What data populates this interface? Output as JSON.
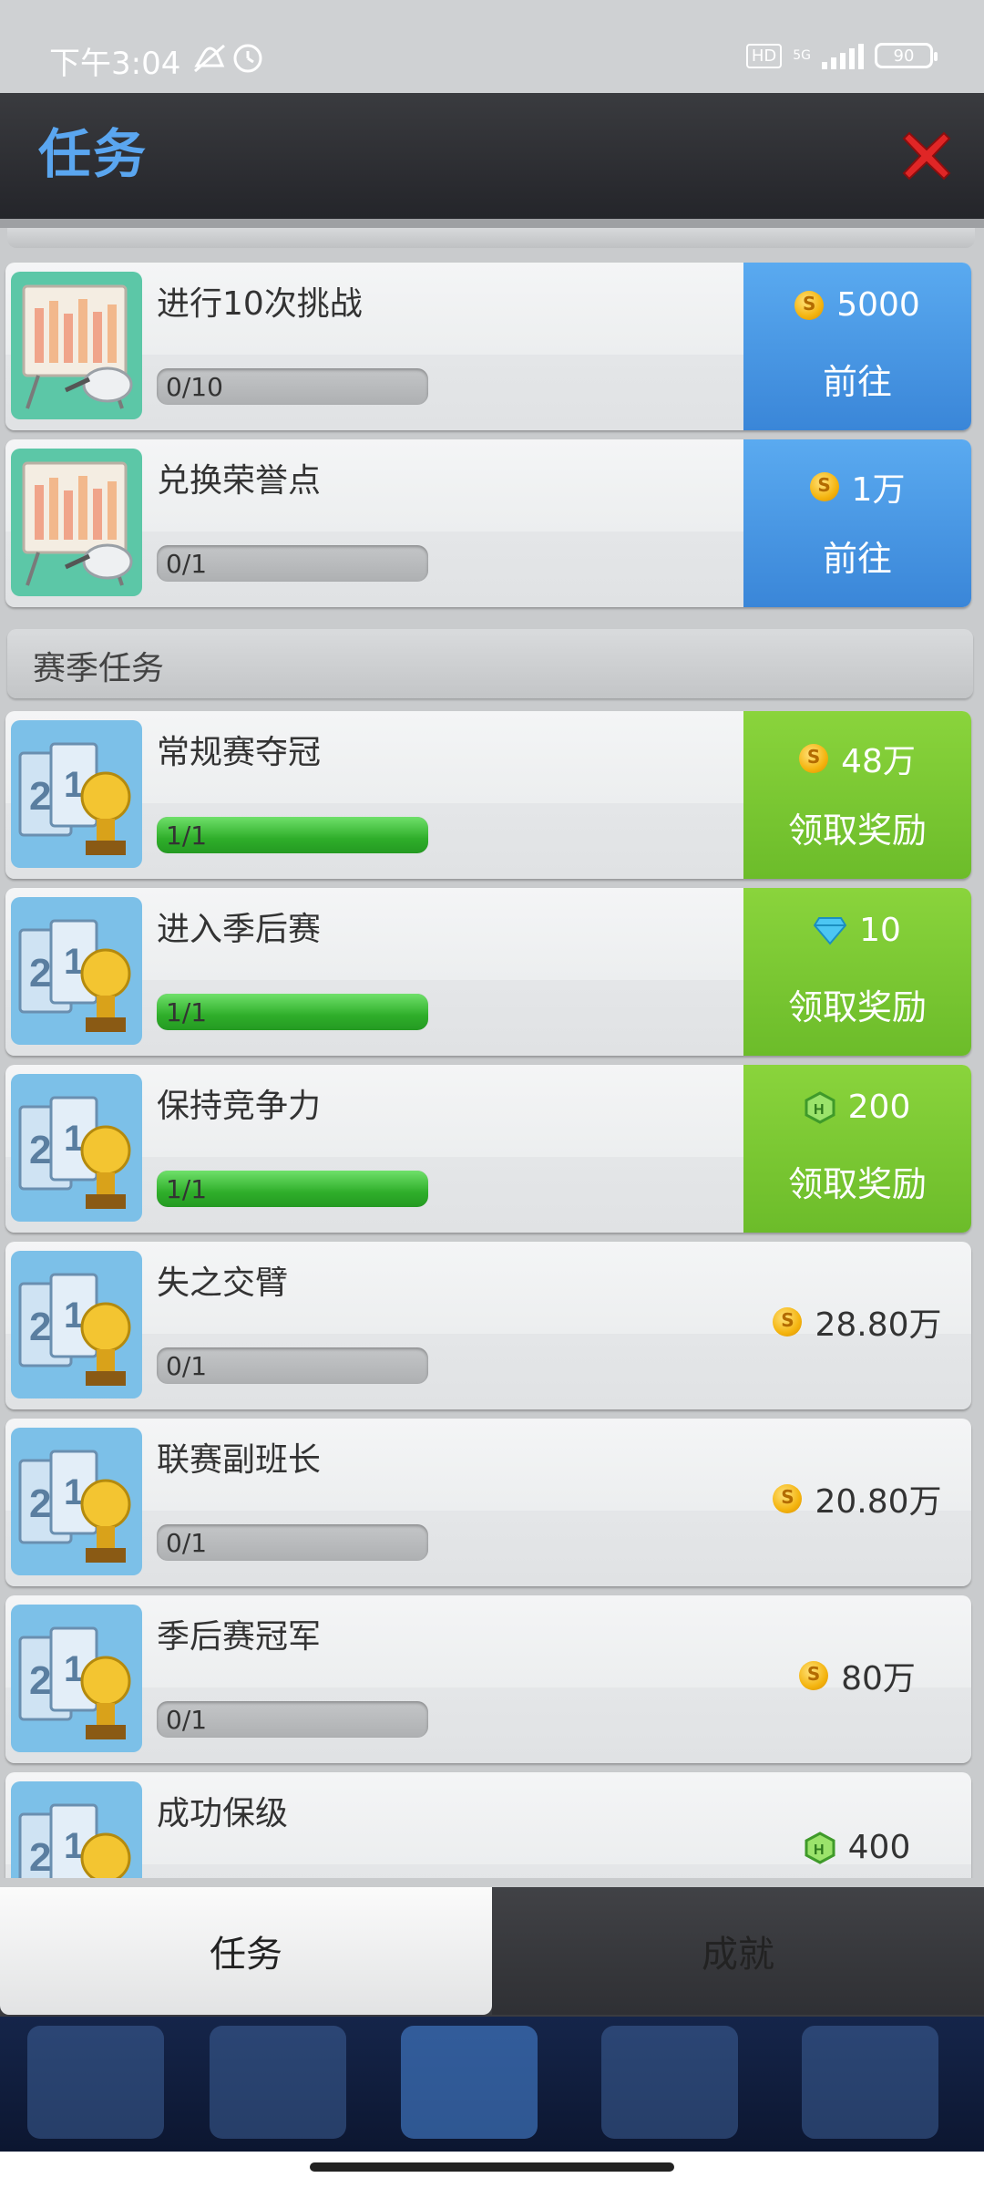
{
  "status_bar": {
    "time": "下午3:04",
    "hd": "HD",
    "network": "5G",
    "battery": "90"
  },
  "header": {
    "title": "任务"
  },
  "tasks_top": [
    {
      "title": "进行10次挑战",
      "progress_text": "0/10",
      "progress": 0,
      "reward_icon": "coin-icon",
      "reward_amount": "5000",
      "action": "前往",
      "style": "blue"
    },
    {
      "title": "兑换荣誉点",
      "progress_text": "0/1",
      "progress": 0,
      "reward_icon": "coin-icon",
      "reward_amount": "1万",
      "action": "前往",
      "style": "blue"
    }
  ],
  "section_title": "赛季任务",
  "season_tasks": [
    {
      "title": "常规赛夺冠",
      "progress_text": "1/1",
      "progress": 1,
      "reward_icon": "coin-icon",
      "reward_amount": "48万",
      "action": "领取奖励",
      "style": "green"
    },
    {
      "title": "进入季后赛",
      "progress_text": "1/1",
      "progress": 1,
      "reward_icon": "diamond-icon",
      "reward_amount": "10",
      "action": "领取奖励",
      "style": "green"
    },
    {
      "title": "保持竞争力",
      "progress_text": "1/1",
      "progress": 1,
      "reward_icon": "hexagon-icon",
      "reward_amount": "200",
      "action": "领取奖励",
      "style": "green"
    },
    {
      "title": "失之交臂",
      "progress_text": "0/1",
      "progress": 0,
      "reward_icon": "coin-icon",
      "reward_amount": "28.80万",
      "action": "",
      "style": "plain"
    },
    {
      "title": "联赛副班长",
      "progress_text": "0/1",
      "progress": 0,
      "reward_icon": "coin-icon",
      "reward_amount": "20.80万",
      "action": "",
      "style": "plain"
    },
    {
      "title": "季后赛冠军",
      "progress_text": "0/1",
      "progress": 0,
      "reward_icon": "coin-icon",
      "reward_amount": "80万",
      "action": "",
      "style": "plain"
    },
    {
      "title": "成功保级",
      "progress_text": "",
      "progress": 0,
      "reward_icon": "hexagon-icon",
      "reward_amount": "400",
      "action": "",
      "style": "plain"
    }
  ],
  "tabs": [
    {
      "label": "任务",
      "active": true
    },
    {
      "label": "成就",
      "active": false
    }
  ],
  "colors": {
    "title_blue": "#5aa6f0",
    "go_blue": "#3a86d8",
    "claim_green": "#6cbc2a",
    "close_red": "#e02626"
  }
}
